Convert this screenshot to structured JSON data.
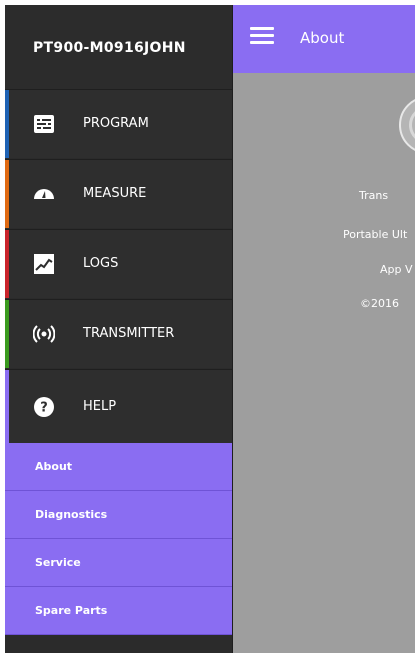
{
  "app": {
    "device_name": "PT900-M0916JOHN",
    "appbar_title": "About"
  },
  "nav": {
    "items": [
      {
        "label": "PROGRAM",
        "icon": "program-list-icon",
        "accent": "#1e62b4"
      },
      {
        "label": "MEASURE",
        "icon": "gauge-icon",
        "accent": "#e06a12"
      },
      {
        "label": "LOGS",
        "icon": "chart-line-icon",
        "accent": "#c9242b"
      },
      {
        "label": "TRANSMITTER",
        "icon": "broadcast-icon",
        "accent": "#3a9a1e"
      },
      {
        "label": "HELP",
        "icon": "question-circle-icon",
        "accent": "#8a6df2"
      }
    ],
    "help_subitems": [
      "About",
      "Diagnostics",
      "Service",
      "Spare Parts"
    ]
  },
  "about": {
    "line1": "Trans",
    "line2": "Portable Ult",
    "line3": "App V",
    "line4": "©2016"
  },
  "colors": {
    "accent": "#8a6df2",
    "drawer_bg": "#2b2b2b",
    "content_bg": "#9e9e9e"
  }
}
